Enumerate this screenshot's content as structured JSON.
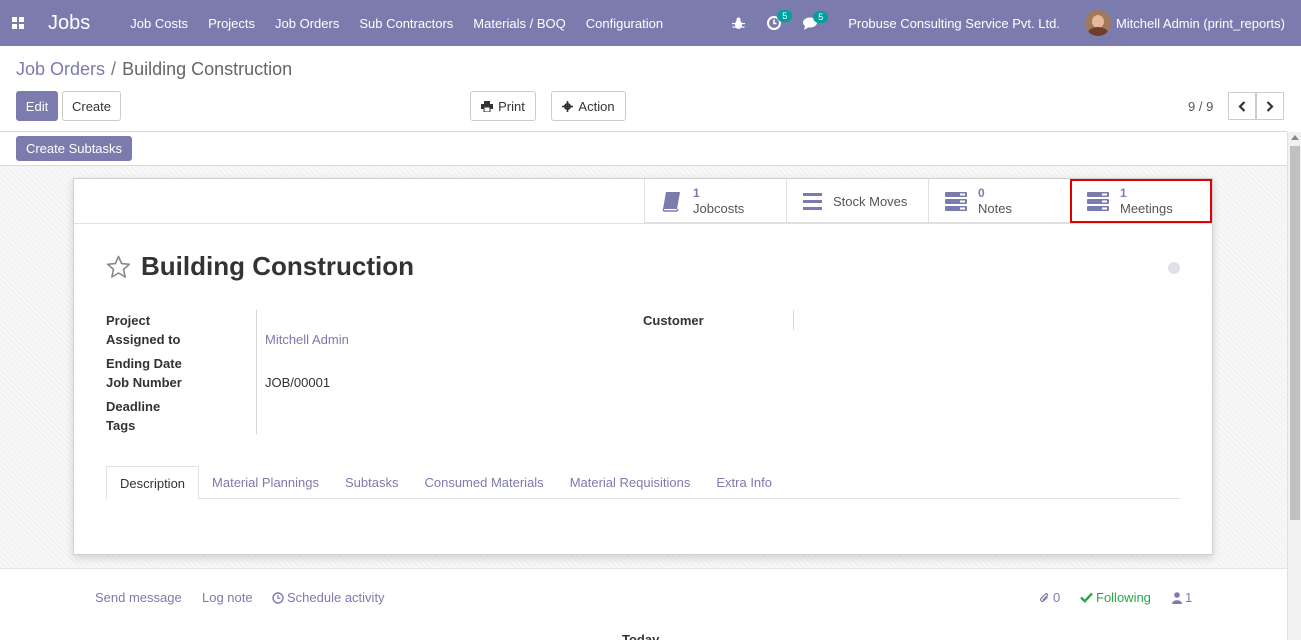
{
  "navbar": {
    "app_name": "Jobs",
    "menu": [
      "Job Costs",
      "Projects",
      "Job Orders",
      "Sub Contractors",
      "Materials / BOQ",
      "Configuration"
    ],
    "activity_badge": "5",
    "message_badge": "5",
    "company": "Probuse Consulting Service Pvt. Ltd.",
    "user": "Mitchell Admin (print_reports)"
  },
  "breadcrumb": {
    "parent": "Job Orders",
    "separator": "/",
    "current": "Building Construction"
  },
  "toolbar": {
    "edit": "Edit",
    "create": "Create",
    "print": "Print",
    "action": "Action"
  },
  "pager": {
    "value": "9 / 9"
  },
  "statusbar": {
    "create_subtasks": "Create Subtasks"
  },
  "smart_buttons": [
    {
      "value": "1",
      "label": "Jobcosts",
      "icon": "book-icon"
    },
    {
      "value": "",
      "label": "Stock Moves",
      "icon": "bars-icon"
    },
    {
      "value": "0",
      "label": "Notes",
      "icon": "server-icon"
    },
    {
      "value": "1",
      "label": "Meetings",
      "icon": "server-icon"
    }
  ],
  "record": {
    "title": "Building Construction",
    "fields": {
      "project_label": "Project",
      "project_value": "",
      "assigned_label": "Assigned to",
      "assigned_value": "Mitchell Admin",
      "ending_date_label": "Ending Date",
      "job_number_label": "Job Number",
      "job_number_value": "JOB/00001",
      "deadline_label": "Deadline",
      "tags_label": "Tags",
      "customer_label": "Customer",
      "customer_value": ""
    }
  },
  "tabs": [
    "Description",
    "Material Plannings",
    "Subtasks",
    "Consumed Materials",
    "Material Requisitions",
    "Extra Info"
  ],
  "chatter": {
    "send_message": "Send message",
    "log_note": "Log note",
    "schedule_activity": "Schedule activity",
    "attachments": "0",
    "following": "Following",
    "followers": "1",
    "today": "Today"
  },
  "colors": {
    "brand": "#7c7bad",
    "following": "#28a745",
    "highlight": "#e00000"
  }
}
